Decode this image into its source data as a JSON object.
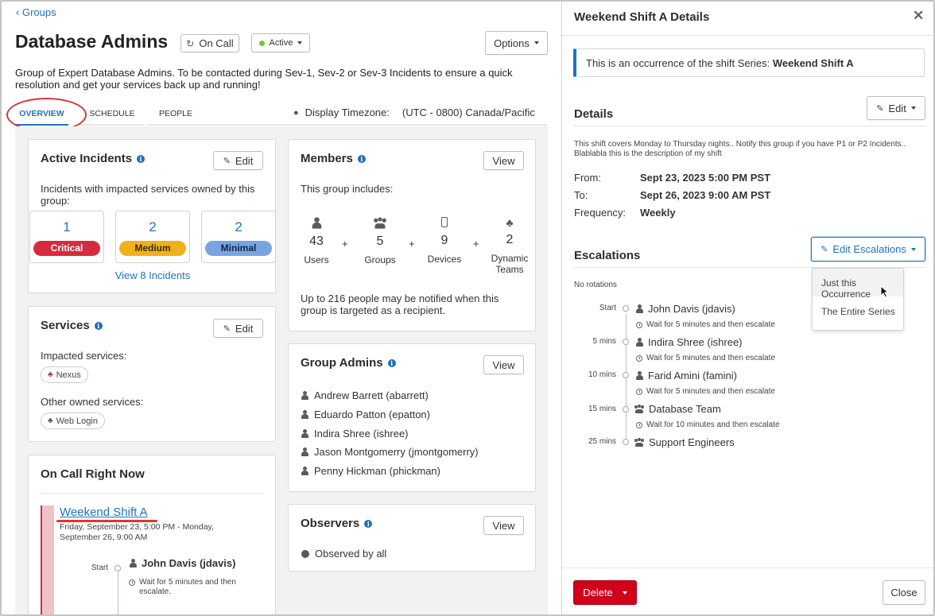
{
  "nav": {
    "back_label": "Groups"
  },
  "header": {
    "title": "Database Admins",
    "oncall_label": "On Call",
    "status_label": "Active",
    "options_label": "Options",
    "description": "Group of Expert Database Admins. To be contacted during Sev-1, Sev-2 or Sev-3 Incidents to ensure a quick resolution and get your services back up and running!"
  },
  "tabs": [
    {
      "label": "OVERVIEW",
      "active": true
    },
    {
      "label": "SCHEDULE",
      "active": false
    },
    {
      "label": "PEOPLE",
      "active": false
    }
  ],
  "timezone": {
    "label": "Display Timezone:",
    "value": "(UTC - 0800) Canada/Pacific"
  },
  "active_incidents": {
    "title": "Active Incidents",
    "edit_label": "Edit",
    "description": "Incidents with impacted services owned by this group:",
    "severities": [
      {
        "count": "1",
        "label": "Critical",
        "color": "#d62b3f",
        "text_color": "#ffffff"
      },
      {
        "count": "2",
        "label": "Medium",
        "color": "#f0b21a",
        "text_color": "#3a2a00"
      },
      {
        "count": "2",
        "label": "Minimal",
        "color": "#7aa4e0",
        "text_color": "#10244a"
      }
    ],
    "view_link": "View 8 Incidents"
  },
  "services": {
    "title": "Services",
    "edit_label": "Edit",
    "impacted_label": "Impacted services:",
    "impacted": [
      "Nexus"
    ],
    "other_label": "Other owned services:",
    "other": [
      "Web Login"
    ]
  },
  "on_call_now": {
    "title": "On Call Right Now",
    "shift_name": "Weekend Shift A",
    "shift_time": "Friday, September 23, 5:00 PM - Monday, September 26, 9:00 AM",
    "start_label": "Start",
    "person": "John Davis (jdavis)",
    "wait_text": "Wait for 5 minutes and then escalate."
  },
  "members": {
    "title": "Members",
    "view_label": "View",
    "includes_label": "This group includes:",
    "stats": [
      {
        "icon": "user-icon",
        "count": "43",
        "label": "Users"
      },
      {
        "icon": "group-icon",
        "count": "5",
        "label": "Groups"
      },
      {
        "icon": "device-icon",
        "count": "9",
        "label": "Devices"
      },
      {
        "icon": "dynamic-teams-icon",
        "count": "2",
        "label": "Dynamic Teams"
      }
    ],
    "plus": "+",
    "note": "Up to 216 people may be notified when this group is targeted as a recipient."
  },
  "group_admins": {
    "title": "Group Admins",
    "view_label": "View",
    "admins": [
      "Andrew Barrett (abarrett)",
      "Eduardo Patton (epatton)",
      "Indira Shree (ishree)",
      "Jason Montgomerry (jmontgomerry)",
      "Penny Hickman (phickman)"
    ]
  },
  "observers": {
    "title": "Observers",
    "view_label": "View",
    "value": "Observed by all"
  },
  "panel": {
    "title": "Weekend Shift A Details",
    "close_icon": "close-icon",
    "notice_prefix": "This is an occurrence of the shift Series:",
    "notice_series": "Weekend Shift A",
    "details_title": "Details",
    "edit_label": "Edit",
    "description": "This shift covers Monday to Thursday nights.. Notify this group if you have P1 or P2 Incidents.. Blablabla this is the description of my shift",
    "from_label": "From:",
    "from_value": "Sept 23, 2023 5:00 PM PST",
    "to_label": "To:",
    "to_value": "Sept 26, 2023 9:00 AM PST",
    "freq_label": "Frequency:",
    "freq_value": "Weekly",
    "escalations_title": "Escalations",
    "edit_escalations_label": "Edit Escalations",
    "dropdown": [
      "Just this Occurrence",
      "The Entire Series"
    ],
    "no_rotations": "No rotations",
    "escalations": [
      {
        "time": "Start",
        "name": "John Davis (jdavis)",
        "type": "user",
        "wait": "Wait for 5 minutes and then escalate"
      },
      {
        "time": "5 mins",
        "name": "Indira Shree (ishree)",
        "type": "user",
        "wait": "Wait for 5 minutes and then escalate"
      },
      {
        "time": "10 mins",
        "name": "Farid Amini (famini)",
        "type": "user",
        "wait": "Wait for 5 minutes and then escalate"
      },
      {
        "time": "15 mins",
        "name": "Database Team",
        "type": "group",
        "wait": "Wait for 10 minutes and then escalate"
      },
      {
        "time": "25 mins",
        "name": "Support Engineers",
        "type": "group",
        "wait": ""
      }
    ],
    "delete_label": "Delete",
    "close_label": "Close"
  },
  "colors": {
    "accent": "#1e73be",
    "danger": "#d0021b",
    "annotation": "#d9363e"
  }
}
